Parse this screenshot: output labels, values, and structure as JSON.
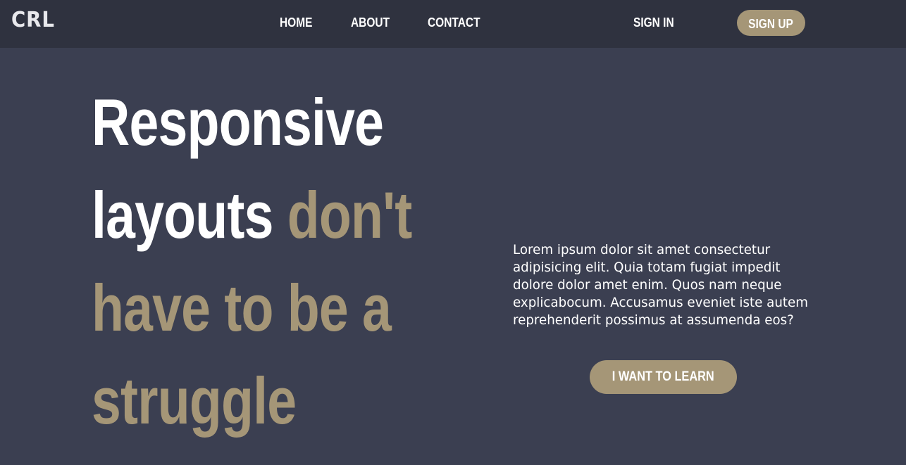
{
  "header": {
    "logo": "CRL",
    "nav": {
      "home": "HOME",
      "about": "ABOUT",
      "contact": "CONTACT",
      "sign_in": "SIGN IN",
      "sign_up": "SIGN UP"
    }
  },
  "hero": {
    "headline": {
      "line1": "Responsive",
      "line2_white": "layouts",
      "line2_gold": "don't",
      "line3": "have to be a",
      "line4": "struggle"
    },
    "body": "Lorem ipsum dolor sit amet consectetur adipisicing elit. Quia totam fugiat impedit dolore dolor amet enim. Quos nam neque explicabocum. Accusamus eveniet iste autem reprehenderit possimus at assumenda eos?",
    "cta_label": "I WANT TO LEARN"
  },
  "colors": {
    "header_bg": "#2f323f",
    "page_bg": "#3b3f51",
    "accent": "#a59677",
    "text": "#ffffff"
  }
}
